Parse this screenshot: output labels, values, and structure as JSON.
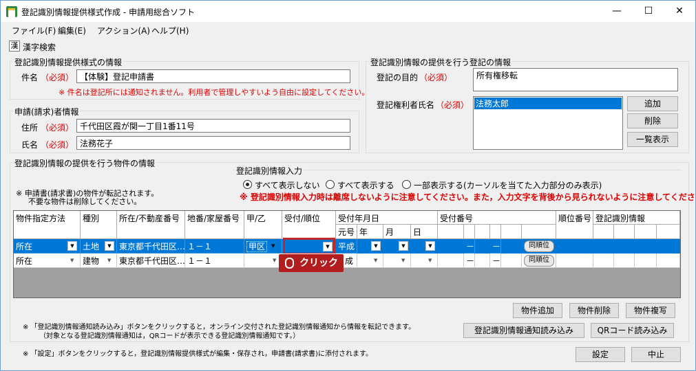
{
  "window": {
    "title": "登記識別情報提供様式作成 - 申請用総合ソフト",
    "minimize": "—",
    "maximize": "☐",
    "close": "✕"
  },
  "menu": [
    "ファイル(F)",
    "編集(E)",
    "アクション(A)",
    "ヘルプ(H)"
  ],
  "toolbar": {
    "kanji_icon": "漢",
    "kanji_search": "漢字検索"
  },
  "form_info": {
    "legend": "登記識別情報提供様式の情報",
    "subject_label": "件名",
    "required": "（必須）",
    "subject_value": "【体験】登記申請書",
    "note": "※ 件名は登記所には通知されません。利用者で管理しやすいよう自由に設定してください。"
  },
  "applicant": {
    "legend": "申請(請求)者情報",
    "address_label": "住所",
    "address_value": "千代田区霞が関一丁目1番11号",
    "name_label": "氏名",
    "name_value": "法務花子"
  },
  "registration": {
    "legend": "登記識別情報の提供を行う登記の情報",
    "purpose_label": "登記の目的",
    "purpose_value": "所有権移転",
    "holder_label": "登記権利者氏名",
    "holder_value": "法務太郎",
    "add": "追加",
    "delete": "削除",
    "list": "一覧表示"
  },
  "property": {
    "legend": "登記識別情報の提供を行う物件の情報",
    "note1": "※ 申請書(請求書)の物件が転記されます。",
    "note2": "不要な物件は削除してください。"
  },
  "input_mode": {
    "legend": "登記識別情報入力",
    "opt1": "すべて表示しない",
    "opt2": "すべて表示する",
    "opt3": "一部表示する(カーソルを当てた入力部分のみ表示)",
    "warning": "※ 登記識別情報入力時は離席しないように注意してください。また，入力文字を背後から見られないように注意してください。"
  },
  "grid": {
    "headers": [
      "物件指定方法",
      "種別",
      "所在/不動産番号",
      "地番/家屋番号",
      "甲/乙",
      "受付/順位",
      "受付年月日",
      "受付番号",
      "順位番号",
      "登記識別情報"
    ],
    "subheaders": [
      "元号",
      "年",
      "月",
      "日"
    ],
    "rows": [
      {
        "method": "所在",
        "type": "土地",
        "location": "東京都千代田区…",
        "lot": "１－１",
        "koot": "甲区",
        "era": "平成",
        "dash1": "－",
        "dash2": "－",
        "order_btn": "同順位"
      },
      {
        "method": "所在",
        "type": "建物",
        "location": "東京都千代田区…",
        "lot": "１－１",
        "koot": "",
        "era": "成",
        "dash1": "－",
        "dash2": "－",
        "order_btn": "同順位"
      }
    ]
  },
  "tooltip": "クリック",
  "buttons": {
    "add_prop": "物件追加",
    "del_prop": "物件削除",
    "copy_prop": "物件複写",
    "read_notice": "登記識別情報通知読み込み",
    "read_qr": "QRコード読み込み",
    "set": "設定",
    "cancel": "中止"
  },
  "notes": {
    "n1": "※ 「登記識別情報通知読み込み」ボタンをクリックすると，オンライン交付された登記識別情報通知から情報を転記できます。",
    "n2": "（対象となる登記識別情報通知は，QRコードが表示できる登記識別情報通知です。）",
    "n3": "※ 「設定」ボタンをクリックすると，登記識別情報提供様式が編集・保存され，申請書(請求書)に添付されます。"
  }
}
